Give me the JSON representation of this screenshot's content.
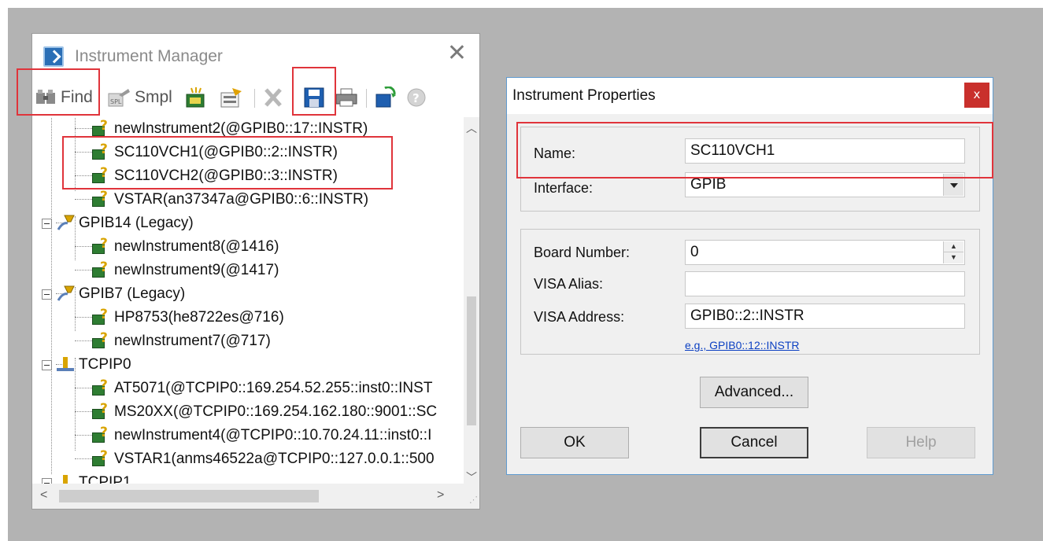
{
  "manager": {
    "title": "Instrument Manager",
    "toolbar": {
      "find_label": "Find",
      "smpl_label": "Smpl"
    },
    "tree": {
      "items": [
        {
          "label": "newInstrument2(@GPIB0::17::INSTR)"
        },
        {
          "label": "SC110VCH1(@GPIB0::2::INSTR)"
        },
        {
          "label": "SC110VCH2(@GPIB0::3::INSTR)"
        },
        {
          "label": "VSTAR(an37347a@GPIB0::6::INSTR)"
        },
        {
          "label": "GPIB14 (Legacy)"
        },
        {
          "label": "newInstrument8(@1416)"
        },
        {
          "label": "newInstrument9(@1417)"
        },
        {
          "label": "GPIB7 (Legacy)"
        },
        {
          "label": "HP8753(he8722es@716)"
        },
        {
          "label": "newInstrument7(@717)"
        },
        {
          "label": "TCPIP0"
        },
        {
          "label": "AT5071(@TCPIP0::169.254.52.255::inst0::INST"
        },
        {
          "label": "MS20XX(@TCPIP0::169.254.162.180::9001::SC"
        },
        {
          "label": "newInstrument4(@TCPIP0::10.70.24.11::inst0::I"
        },
        {
          "label": "VSTAR1(anms46522a@TCPIP0::127.0.0.1::500"
        },
        {
          "label": "TCPIP1"
        }
      ]
    }
  },
  "properties": {
    "title": "Instrument Properties",
    "close_glyph": "x",
    "name_label": "Name:",
    "name_value": "SC110VCH1",
    "interface_label": "Interface:",
    "interface_value": "GPIB",
    "board_label": "Board Number:",
    "board_value": "0",
    "alias_label": "VISA Alias:",
    "alias_value": "",
    "address_label": "VISA Address:",
    "address_value": "GPIB0::2::INSTR",
    "address_example": "e.g., GPIB0::12::INSTR",
    "advanced_label": "Advanced...",
    "ok_label": "OK",
    "cancel_label": "Cancel",
    "help_label": "Help"
  },
  "colors": {
    "highlight_box": "#e0343b",
    "desktop": "#b3b3b3",
    "close_button": "#c9302c"
  }
}
